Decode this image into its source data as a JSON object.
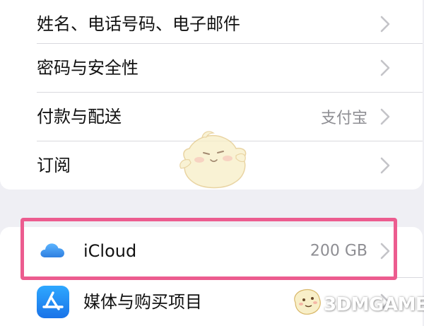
{
  "settings": {
    "rows": [
      {
        "label": "姓名、电话号码、电子邮件",
        "value": ""
      },
      {
        "label": "密码与安全性",
        "value": ""
      },
      {
        "label": "付款与配送",
        "value": "支付宝"
      },
      {
        "label": "订阅",
        "value": ""
      }
    ],
    "icloud": {
      "label": "iCloud",
      "value": "200 GB"
    },
    "media": {
      "label": "媒体与购买项目"
    }
  },
  "watermark": {
    "text": "3DMGAME"
  },
  "colors": {
    "highlight": "#ec5c8f",
    "background": "#efeff4",
    "secondary_text": "#8e8e93",
    "icloud_blue": "#3d8fe8"
  }
}
